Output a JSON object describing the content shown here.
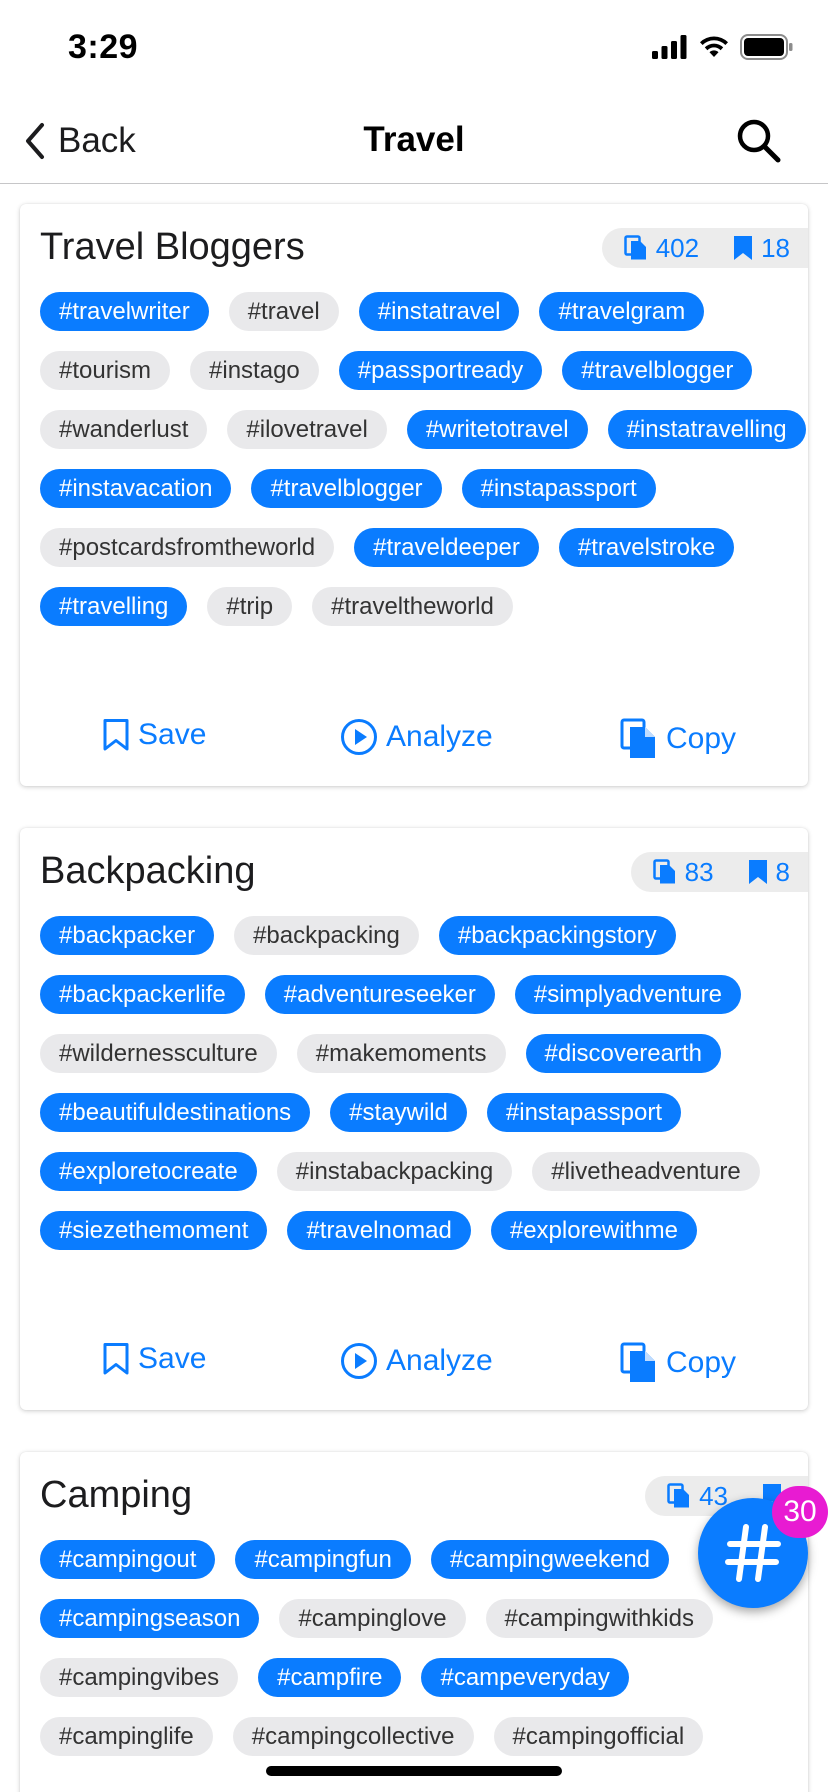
{
  "status_bar": {
    "time": "3:29"
  },
  "nav": {
    "back_label": "Back",
    "title": "Travel"
  },
  "colors": {
    "accent": "#0a7cff",
    "chip_plain": "#e9e9eb",
    "badge": "#e81bd2"
  },
  "cards": [
    {
      "title": "Travel Bloggers",
      "posts_count": "402",
      "saves_count": "18",
      "tags": [
        {
          "label": "#travelwriter",
          "selected": true
        },
        {
          "label": "#travel",
          "selected": false
        },
        {
          "label": "#instatravel",
          "selected": true
        },
        {
          "label": "#travelgram",
          "selected": true
        },
        {
          "label": "#tourism",
          "selected": false
        },
        {
          "label": "#instago",
          "selected": false
        },
        {
          "label": "#passportready",
          "selected": true
        },
        {
          "label": "#travelblogger",
          "selected": true
        },
        {
          "label": "#wanderlust",
          "selected": false
        },
        {
          "label": "#ilovetravel",
          "selected": false
        },
        {
          "label": "#writetotravel",
          "selected": true
        },
        {
          "label": "#instatravelling",
          "selected": true
        },
        {
          "label": "#instavacation",
          "selected": true
        },
        {
          "label": "#travelblogger",
          "selected": true
        },
        {
          "label": "#instapassport",
          "selected": true
        },
        {
          "label": "#postcardsfromtheworld",
          "selected": false
        },
        {
          "label": "#traveldeeper",
          "selected": true
        },
        {
          "label": "#travelstroke",
          "selected": true
        },
        {
          "label": "#travelling",
          "selected": true
        },
        {
          "label": "#trip",
          "selected": false
        },
        {
          "label": "#traveltheworld",
          "selected": false
        }
      ],
      "actions": {
        "save": "Save",
        "analyze": "Analyze",
        "copy": "Copy"
      }
    },
    {
      "title": "Backpacking",
      "posts_count": "83",
      "saves_count": "8",
      "tags": [
        {
          "label": "#backpacker",
          "selected": true
        },
        {
          "label": "#backpacking",
          "selected": false
        },
        {
          "label": "#backpackingstory",
          "selected": true
        },
        {
          "label": "#backpackerlife",
          "selected": true
        },
        {
          "label": "#adventureseeker",
          "selected": true
        },
        {
          "label": "#simplyadventure",
          "selected": true
        },
        {
          "label": "#wildernessculture",
          "selected": false
        },
        {
          "label": "#makemoments",
          "selected": false
        },
        {
          "label": "#discoverearth",
          "selected": true
        },
        {
          "label": "#beautifuldestinations",
          "selected": true
        },
        {
          "label": "#staywild",
          "selected": true
        },
        {
          "label": "#instapassport",
          "selected": true
        },
        {
          "label": "#exploretocreate",
          "selected": true
        },
        {
          "label": "#instabackpacking",
          "selected": false
        },
        {
          "label": "#livetheadventure",
          "selected": false
        },
        {
          "label": "#siezethemoment",
          "selected": true
        },
        {
          "label": "#travelnomad",
          "selected": true
        },
        {
          "label": "#explorewithme",
          "selected": true
        }
      ],
      "actions": {
        "save": "Save",
        "analyze": "Analyze",
        "copy": "Copy"
      }
    },
    {
      "title": "Camping",
      "posts_count": "43",
      "saves_count": "",
      "tags": [
        {
          "label": "#campingout",
          "selected": true
        },
        {
          "label": "#campingfun",
          "selected": true
        },
        {
          "label": "#campingweekend",
          "selected": true
        },
        {
          "label": "#campingseason",
          "selected": true
        },
        {
          "label": "#campinglove",
          "selected": false
        },
        {
          "label": "#campingwithkids",
          "selected": false
        },
        {
          "label": "#campingvibes",
          "selected": false
        },
        {
          "label": "#campfire",
          "selected": true
        },
        {
          "label": "#campeveryday",
          "selected": true
        },
        {
          "label": "#campinglife",
          "selected": false
        },
        {
          "label": "#campingcollective",
          "selected": false
        },
        {
          "label": "#campingofficial",
          "selected": false
        }
      ]
    }
  ],
  "fab": {
    "icon": "hashtag-icon",
    "badge_count": "30"
  }
}
